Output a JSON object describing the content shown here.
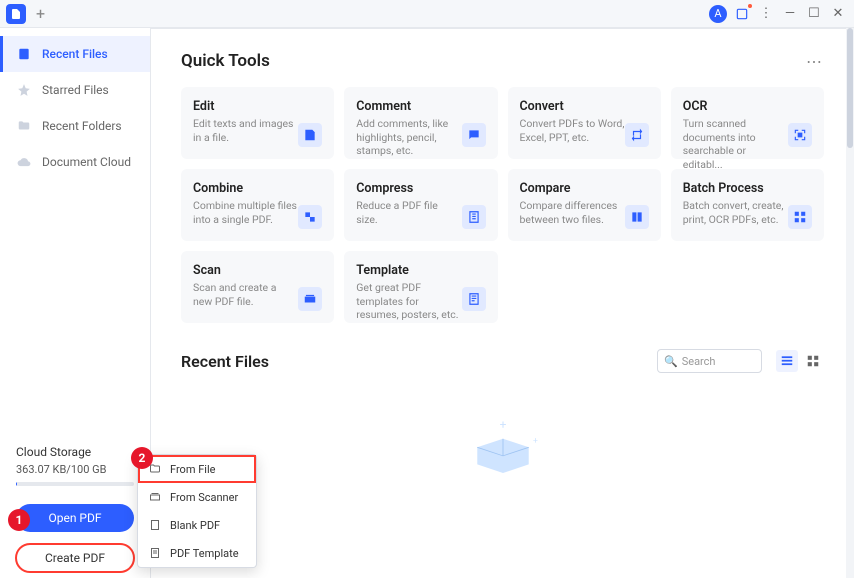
{
  "titlebar": {
    "avatar_initial": "A"
  },
  "sidebar": {
    "items": [
      {
        "label": "Recent Files"
      },
      {
        "label": "Starred Files"
      },
      {
        "label": "Recent Folders"
      },
      {
        "label": "Document Cloud"
      }
    ],
    "cloud": {
      "title": "Cloud Storage",
      "usage": "363.07 KB/100 GB"
    },
    "open_label": "Open PDF",
    "create_label": "Create PDF"
  },
  "quick_tools": {
    "heading": "Quick Tools",
    "cards": [
      {
        "title": "Edit",
        "desc": "Edit texts and images in a file."
      },
      {
        "title": "Comment",
        "desc": "Add comments, like highlights, pencil, stamps, etc."
      },
      {
        "title": "Convert",
        "desc": "Convert PDFs to Word, Excel, PPT, etc."
      },
      {
        "title": "OCR",
        "desc": "Turn scanned documents into searchable or editabl..."
      },
      {
        "title": "Combine",
        "desc": "Combine multiple files into a single PDF."
      },
      {
        "title": "Compress",
        "desc": "Reduce a PDF file size."
      },
      {
        "title": "Compare",
        "desc": "Compare differences between two files."
      },
      {
        "title": "Batch Process",
        "desc": "Batch convert, create, print, OCR PDFs, etc."
      },
      {
        "title": "Scan",
        "desc": "Scan and create a new PDF file."
      },
      {
        "title": "Template",
        "desc": "Get great PDF templates for resumes, posters, etc."
      }
    ]
  },
  "recent": {
    "heading": "Recent Files",
    "search_placeholder": "Search"
  },
  "create_menu": {
    "items": [
      {
        "label": "From File"
      },
      {
        "label": "From Scanner"
      },
      {
        "label": "Blank PDF"
      },
      {
        "label": "PDF Template"
      }
    ]
  },
  "callouts": {
    "one": "1",
    "two": "2"
  }
}
